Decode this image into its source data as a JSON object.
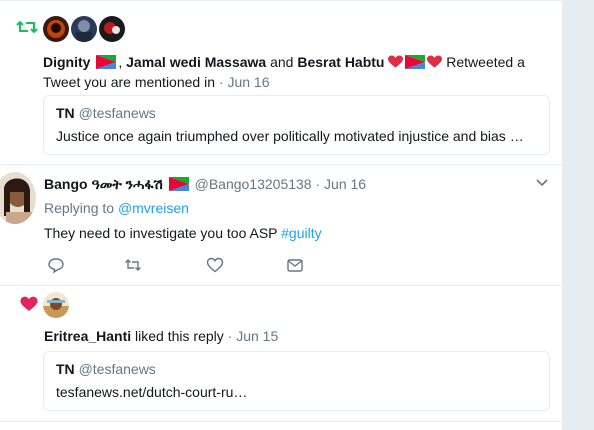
{
  "colors": {
    "retweet_green": "#17bf63",
    "like_red": "#e0245e",
    "link_blue": "#1da1f2",
    "muted_gray": "#657786"
  },
  "notification_retweet": {
    "icon": "retweet-icon",
    "names": [
      "Dignity",
      "Jamal wedi Massawa",
      "Besrat Habtu"
    ],
    "sep1": ", ",
    "sep2": " and ",
    "action": " Retweeted a Tweet you are mentioned in",
    "date": "Jun 16",
    "quote": {
      "name": "TN",
      "handle": "@tesfanews",
      "text": "Justice once again triumphed over politically motivated injustice and bias …"
    }
  },
  "tweet": {
    "name": "Bango ዓመት ንሓፋሽ",
    "handle": "@Bango13205138",
    "date": "Jun 16",
    "replying_prefix": "Replying to ",
    "replying_to": "@mvreisen",
    "text": "They need to investigate you too ASP ",
    "hashtag": "#guilty",
    "actions": [
      "reply-icon",
      "retweet-icon",
      "like-icon",
      "message-icon"
    ]
  },
  "notification_like": {
    "icon": "heart-icon",
    "name": "Eritrea_Hanti",
    "action": " liked this reply",
    "date": "Jun 15",
    "quote": {
      "name": "TN",
      "handle": "@tesfanews",
      "text": "tesfanews.net/dutch-court-ru…"
    }
  }
}
